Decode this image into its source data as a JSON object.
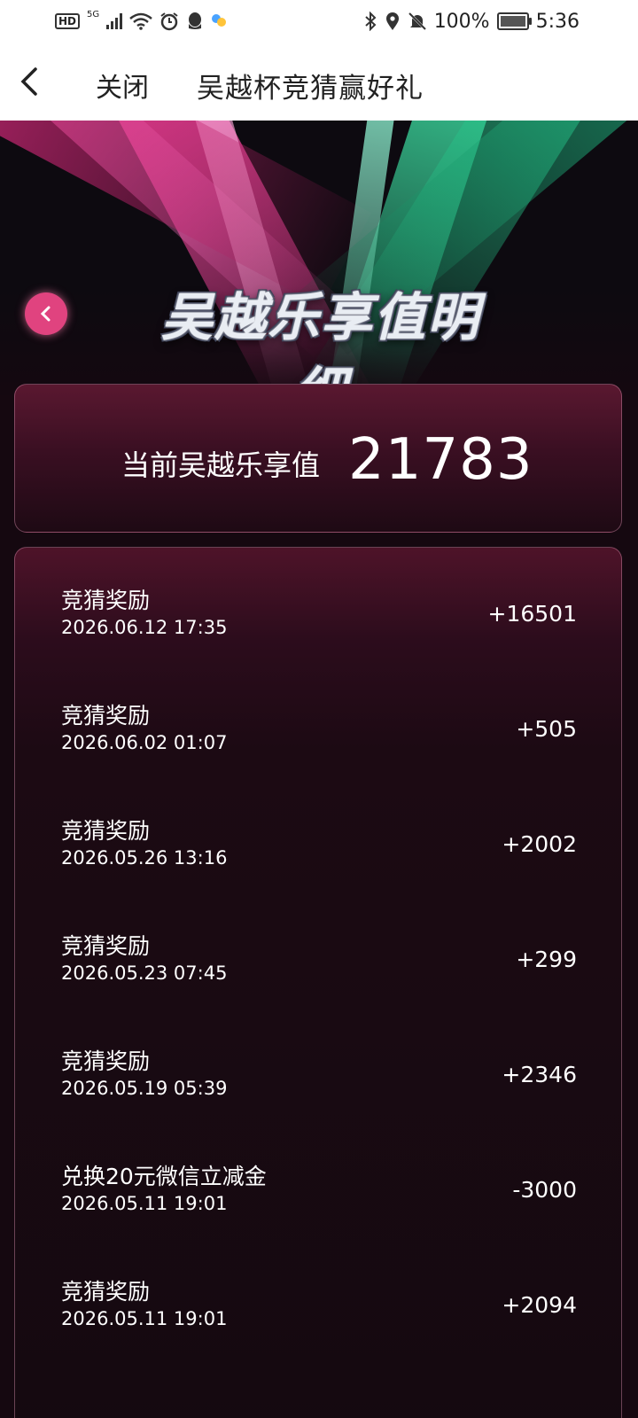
{
  "status_bar": {
    "hd": "HD",
    "network": "5G",
    "battery_percent": "100%",
    "time": "5:36",
    "battery_level": 1.0,
    "icons": [
      "hd-icon",
      "signal-icon",
      "wifi-icon",
      "alarm-icon",
      "qq-icon",
      "app-icon",
      "bluetooth-icon",
      "location-icon",
      "mute-icon",
      "battery-icon"
    ]
  },
  "nav": {
    "close_label": "关闭",
    "title": "吴越杯竞猜赢好礼",
    "back_icon": "chevron-left-icon"
  },
  "banner": {
    "title": "吴越乐享值明细",
    "back_icon": "chevron-left-icon",
    "colors": {
      "pink": "#e0437f",
      "green": "#2fc48a"
    }
  },
  "total": {
    "label": "当前吴越乐享值",
    "value": "21783"
  },
  "records": [
    {
      "title": "竞猜奖励",
      "time": "2026.06.12 17:35",
      "amount": "+16501"
    },
    {
      "title": "竞猜奖励",
      "time": "2026.06.02 01:07",
      "amount": "+505"
    },
    {
      "title": "竞猜奖励",
      "time": "2026.05.26 13:16",
      "amount": "+2002"
    },
    {
      "title": "竞猜奖励",
      "time": "2026.05.23 07:45",
      "amount": "+299"
    },
    {
      "title": "竞猜奖励",
      "time": "2026.05.19 05:39",
      "amount": "+2346"
    },
    {
      "title": "兑换20元微信立减金",
      "time": "2026.05.11 19:01",
      "amount": "-3000"
    },
    {
      "title": "竞猜奖励",
      "time": "2026.05.11 19:01",
      "amount": "+2094"
    }
  ]
}
